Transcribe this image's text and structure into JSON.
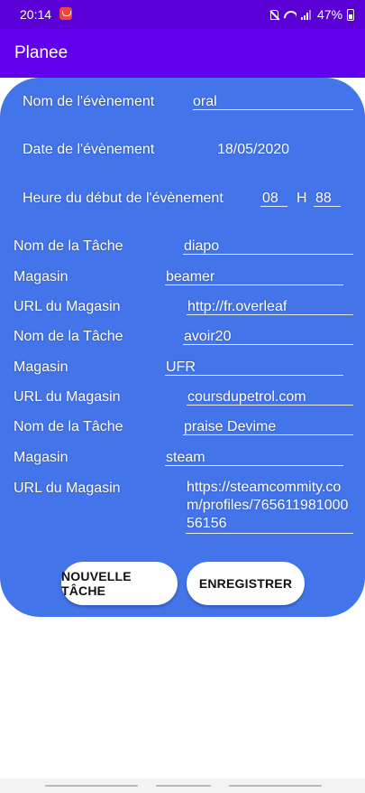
{
  "status": {
    "time": "20:14",
    "battery": "47%"
  },
  "app": {
    "title": "Planee"
  },
  "event": {
    "name_label": "Nom de l'évènement",
    "name_value": "oral",
    "date_label": "Date de l'évènement",
    "date_value": "18/05/2020",
    "start_label": "Heure du début de l'évènement",
    "hour_value": "08",
    "hour_sep": "H",
    "minute_value": "88"
  },
  "tasks": [
    {
      "task_label": "Nom de la Tâche",
      "task": "diapo",
      "store_label": "Magasin",
      "store": "beamer",
      "url_label": "URL du Magasin",
      "url": "http://fr.overleaf"
    },
    {
      "task_label": "Nom de la Tâche",
      "task": "avoir20",
      "store_label": "Magasin",
      "store": "UFR",
      "url_label": "URL du Magasin",
      "url": "coursdupetrol.com"
    },
    {
      "task_label": "Nom de la Tâche",
      "task": "praise Devime",
      "store_label": "Magasin",
      "store": "steam",
      "url_label": "URL du Magasin",
      "url": "https://steamcommity.com/profiles/76561198100056156"
    }
  ],
  "buttons": {
    "new_task": "NOUVELLE TÂCHE",
    "save": "ENREGISTRER"
  },
  "colors": {
    "status_bar": "#5a00d6",
    "app_bar": "#6200ee",
    "card": "#4374ea"
  }
}
